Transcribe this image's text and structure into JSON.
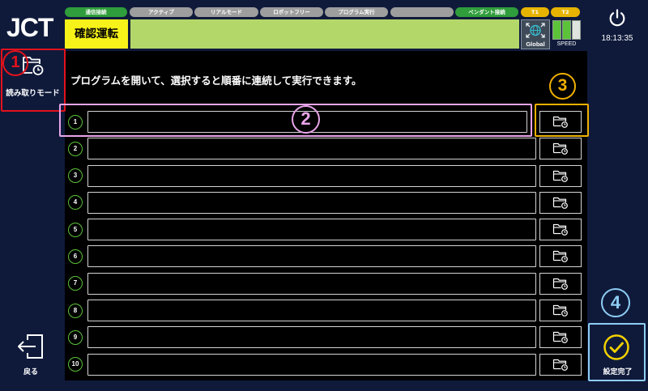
{
  "app": {
    "logo": "JCT"
  },
  "status_bar": {
    "indicators": [
      {
        "label": "通信接続",
        "color": "#2f9d3b"
      },
      {
        "label": "アクティブ",
        "color": "#9e9e9e"
      },
      {
        "label": "リアルモード",
        "color": "#9e9e9e"
      },
      {
        "label": "ロボットフリー",
        "color": "#9e9e9e"
      },
      {
        "label": "プログラム実行",
        "color": "#9e9e9e"
      },
      {
        "label": "",
        "color": "#9e9e9e"
      },
      {
        "label": "ペンダント接続",
        "color": "#2f9d3b"
      },
      {
        "label": "T1",
        "color": "#e6b400"
      },
      {
        "label": "T2",
        "color": "#e6b400"
      }
    ]
  },
  "mode": {
    "label": "確認運転",
    "color": "#f7f31a"
  },
  "message_bar": {
    "text": "",
    "color": "#b4d76a"
  },
  "coordinate": {
    "label": "Global",
    "icon": "globe-icon"
  },
  "speed": {
    "label": "SPEED",
    "level": 2,
    "max": 3,
    "color": "#5cc23a"
  },
  "system": {
    "time": "18:13:35",
    "icon": "power-icon"
  },
  "sidebar": {
    "read_mode": {
      "label": "読み取りモード",
      "icon": "folder-clock-icon"
    },
    "back": {
      "label": "戻る",
      "icon": "exit-icon"
    }
  },
  "main": {
    "instruction": "プログラムを開いて、選択すると順番に連続して実行できます。",
    "browse_icon": "folder-clock-icon",
    "rows": [
      {
        "number": "1",
        "program": ""
      },
      {
        "number": "2",
        "program": ""
      },
      {
        "number": "3",
        "program": ""
      },
      {
        "number": "4",
        "program": ""
      },
      {
        "number": "5",
        "program": ""
      },
      {
        "number": "6",
        "program": ""
      },
      {
        "number": "7",
        "program": ""
      },
      {
        "number": "8",
        "program": ""
      },
      {
        "number": "9",
        "program": ""
      },
      {
        "number": "10",
        "program": ""
      }
    ]
  },
  "confirm": {
    "label": "設定完了",
    "icon": "check-circle-icon",
    "color": "#f3d100"
  },
  "annotations": [
    {
      "label": "1",
      "color": "#e3121b"
    },
    {
      "label": "2",
      "color": "#e9a4e9"
    },
    {
      "label": "3",
      "color": "#f0b000"
    },
    {
      "label": "4",
      "color": "#8ecdf3"
    }
  ],
  "theme": {
    "background": "#0f1a3b",
    "panel": "#000000",
    "row_ring": "#5cc23a"
  }
}
